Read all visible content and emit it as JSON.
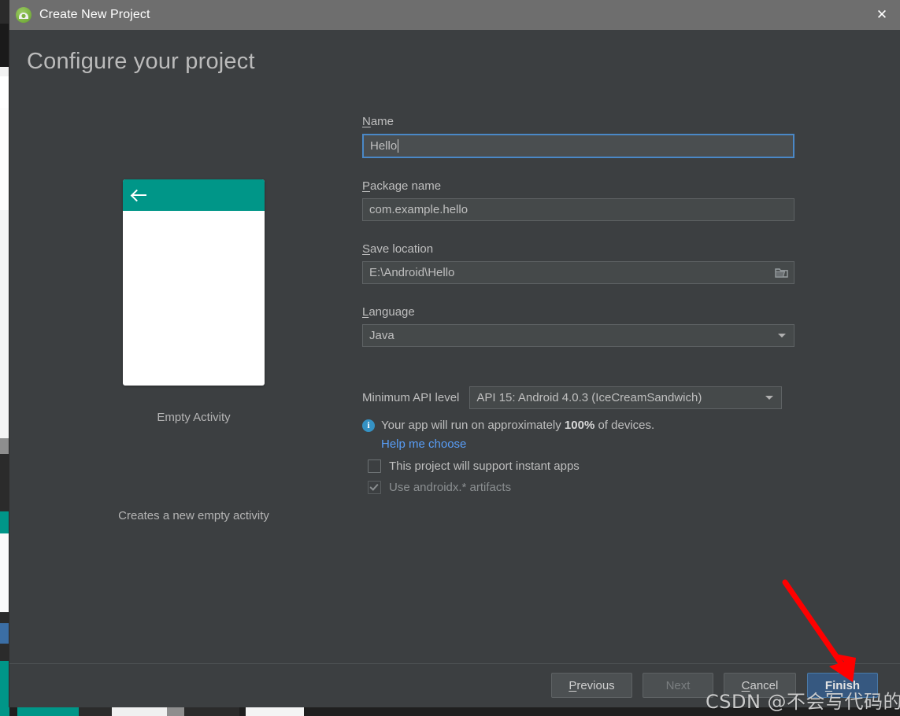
{
  "window": {
    "title": "Create New Project",
    "app_icon": "android-studio-icon",
    "close_icon": "close-icon"
  },
  "page": {
    "heading": "Configure your project"
  },
  "preview": {
    "template_name": "Empty Activity",
    "description": "Creates a new empty activity",
    "appbar_color": "#009688",
    "back_icon": "back-arrow-icon"
  },
  "form": {
    "name": {
      "label": "Name",
      "mnemonic": "N",
      "value": "Hello",
      "focused": true
    },
    "package_name": {
      "label": "Package name",
      "mnemonic": "P",
      "value": "com.example.hello"
    },
    "save_location": {
      "label": "Save location",
      "mnemonic": "S",
      "value": "E:\\Android\\Hello",
      "browse_icon": "folder-icon"
    },
    "language": {
      "label": "Language",
      "mnemonic": "L",
      "value": "Java",
      "dropdown_icon": "chevron-down-icon"
    },
    "min_api": {
      "label": "Minimum API level",
      "value": "API 15: Android 4.0.3 (IceCreamSandwich)",
      "dropdown_icon": "chevron-down-icon"
    },
    "device_info": {
      "icon": "info-icon",
      "prefix": "Your app will run on approximately ",
      "percent": "100%",
      "suffix": " of devices.",
      "accent_color": "#3592c4"
    },
    "help_link": {
      "label": "Help me choose",
      "color": "#589df6"
    },
    "instant_apps_checkbox": {
      "label": "This project will support instant apps",
      "checked": false,
      "disabled": false
    },
    "androidx_checkbox": {
      "label": "Use androidx.* artifacts",
      "checked": true,
      "disabled": true
    }
  },
  "footer": {
    "previous": {
      "label": "Previous",
      "mnemonic": "P",
      "disabled": false
    },
    "next": {
      "label": "Next",
      "disabled": true
    },
    "cancel": {
      "label": "Cancel",
      "mnemonic": "C",
      "disabled": false
    },
    "finish": {
      "label": "Finish",
      "mnemonic": "F",
      "primary": true,
      "color": "#365880"
    }
  },
  "annotations": {
    "arrow_color": "#ff0000",
    "watermark": "CSDN @不会写代码的程序"
  }
}
